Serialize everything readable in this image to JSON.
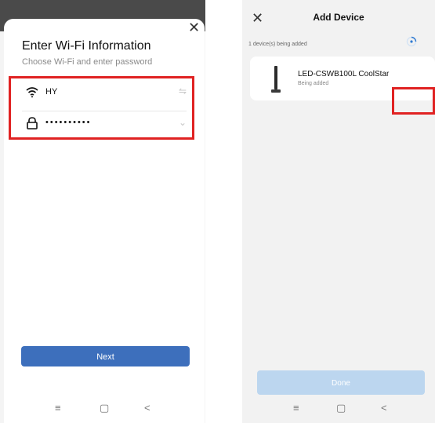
{
  "wifi_screen": {
    "title": "Enter Wi-Fi Information",
    "subtitle": "Choose Wi-Fi and enter password",
    "network_name": "HY",
    "password_mask": "••••••••••",
    "next_label": "Next"
  },
  "add_device_screen": {
    "title": "Add Device",
    "count_text": "1 device(s) being added",
    "device_name": "LED-CSWB100L CoolStar",
    "device_status": "Being added",
    "done_label": "Done"
  },
  "icons": {
    "close": "close-icon",
    "wifi": "wifi-icon",
    "lock": "lock-icon",
    "swap": "swap-icon",
    "chevron": "chevron-down-icon",
    "lamp": "lamp-icon",
    "spinner": "spinner-icon",
    "menu": "menu-icon",
    "home": "home-icon",
    "back": "back-icon"
  },
  "colors": {
    "highlight": "#e02222",
    "primary_button": "#3d6fbc",
    "disabled_button": "#bcd6ef",
    "spinner": "#2f7ad1"
  }
}
